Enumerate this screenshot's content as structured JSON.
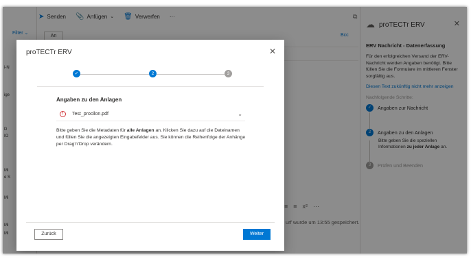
{
  "toolbar": {
    "send_label": "Senden",
    "attach_label": "Anfügen",
    "discard_label": "Verwerfen",
    "more_label": "···"
  },
  "compose": {
    "filter_label": "Filter",
    "to_button": "An",
    "bcc_label": "Bcc",
    "format_icons": [
      "≡",
      "≡",
      "x²",
      "···"
    ],
    "saved_status": "urf wurde um 13:55 gespeichert."
  },
  "sidebar_fragments": [
    "i-N",
    "ige",
    "D",
    "IO",
    "Mi",
    "e S",
    "Mi",
    "Mi",
    "Mi"
  ],
  "pane": {
    "title": "proTECTr ERV",
    "heading": "ERV Nachricht - Datenerfassung",
    "intro": "Für den erfolgreichen Versand der ERV-Nachricht werden Angaben benötigt. Bitte füllen Sie die Formulare im mittleren Fenster sorgfältig aus.",
    "hide_link": "Diesen Text zukünftig nicht mehr anzeigen",
    "next_steps_label": "Nachfolgende Schritte:",
    "steps": [
      {
        "number": "✓",
        "label": "Angaben zur Nachricht",
        "state": "done"
      },
      {
        "number": "2",
        "label": "Angaben zu den Anlagen",
        "state": "active"
      },
      {
        "number": "3",
        "label": "Prüfen und Beenden",
        "state": "pending"
      }
    ],
    "step2_desc_pre": "Bitte geben Sie die speziellen Informationen ",
    "step2_desc_bold": "zu jeder Anlage",
    "step2_desc_post": " an."
  },
  "modal": {
    "title": "proTECTr ERV",
    "stepper": [
      "✓",
      "2",
      "3"
    ],
    "section_title": "Angaben zu den Anlagen",
    "file_name": "Test_procilon.pdf",
    "help_pre": "Bitte geben Sie die Metadaten für ",
    "help_bold": "alle Anlagen",
    "help_post": " an. Klicken Sie dazu auf die Dateinamen und füllen Sie die angezeigten Eingabefelder aus. Sie können die Reihenfolge der Anhänge per Drag'n'Drop verändern.",
    "back_label": "Zurück",
    "next_label": "Weiter"
  },
  "colors": {
    "accent": "#0078d4",
    "step_done": "#0078d4",
    "step_pending": "#a19f9d",
    "warning": "#d13438"
  }
}
